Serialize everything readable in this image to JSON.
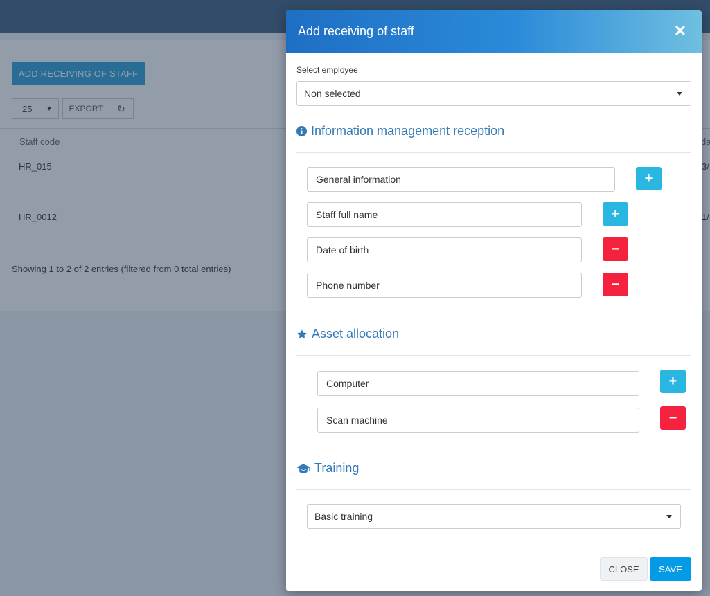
{
  "background": {
    "add_button_label": "ADD RECEIVING OF STAFF",
    "page_size": "25",
    "export_label": "EXPORT",
    "table_header": {
      "staff_code": "Staff code",
      "right_clipped": "da"
    },
    "rows": [
      {
        "code": "HR_015",
        "right_clipped": "3/"
      },
      {
        "code": "HR_0012",
        "right_clipped": "1/"
      }
    ],
    "showing_text": "Showing 1 to 2 of 2 entries (filtered from 0 total entries)"
  },
  "modal": {
    "title": "Add receiving of staff",
    "select_employee_label": "Select employee",
    "select_employee_value": "Non selected",
    "info_section_title": "Information management reception",
    "info_fields": [
      "General information",
      "Staff full name",
      "Date of birth",
      "Phone number"
    ],
    "asset_section_title": "Asset allocation",
    "asset_fields": [
      "Computer",
      "Scan machine"
    ],
    "training_section_title": "Training",
    "training_value": "Basic training",
    "close_label": "CLOSE",
    "save_label": "SAVE"
  },
  "colors": {
    "header_gradient_start": "#1e6fc4",
    "header_gradient_end": "#6fbfe0",
    "plus_button": "#29b6e0",
    "minus_button": "#f5223f",
    "save_button": "#039be5",
    "section_title": "#337ab7"
  },
  "icons": {
    "info": "info-circle-icon",
    "asset": "star-icon",
    "training": "graduation-cap-icon",
    "add": "plus-icon",
    "remove": "minus-icon",
    "close": "times-icon",
    "refresh": "refresh-icon"
  }
}
